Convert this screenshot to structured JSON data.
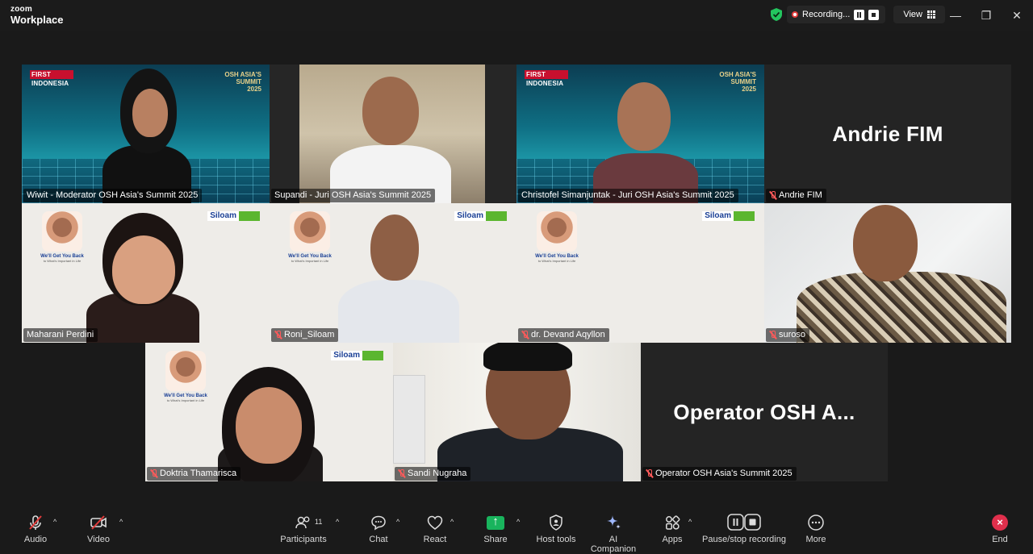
{
  "app": {
    "brand_small": "zoom",
    "brand_large": "Workplace"
  },
  "top": {
    "recording_label": "Recording...",
    "view_label": "View"
  },
  "window": {
    "minimize": "—",
    "restore": "❐",
    "close": "✕"
  },
  "participants": [
    {
      "name": "Wiwit - Moderator OSH Asia's Summit 2025",
      "muted": false,
      "active": true
    },
    {
      "name": "Supandi - Juri OSH Asia's Summit 2025",
      "muted": false
    },
    {
      "name": "Christofel Simanjuntak - Juri OSH Asia's Summit 2025",
      "muted": false
    },
    {
      "name": "Andrie FIM",
      "muted": true,
      "display": "Andrie FIM"
    },
    {
      "name": "Maharani Perdini",
      "muted": false
    },
    {
      "name": "Roni_Siloam",
      "muted": true
    },
    {
      "name": "dr. Devand Aqyllon",
      "muted": true
    },
    {
      "name": "suroso",
      "muted": true
    },
    {
      "name": "Doktria Thamarisca",
      "muted": true
    },
    {
      "name": "Sandi Nugraha",
      "muted": true
    },
    {
      "name": "Operator OSH Asia's Summit 2025",
      "muted": true,
      "display": "Operator OSH A..."
    }
  ],
  "backgrounds": {
    "first_indonesia": "FIRST INDONESIA",
    "osh_summit": [
      "OSH ASIA'S",
      "SUMMIT",
      "2025"
    ],
    "siloam": "Siloam",
    "siloam_tag": "Hospitals",
    "siloam_poster_title": "We'll Get You Back",
    "siloam_poster_sub": "to What's Important in Life"
  },
  "toolbar": {
    "audio": "Audio",
    "video": "Video",
    "participants": "Participants",
    "participants_count": "11",
    "chat": "Chat",
    "react": "React",
    "share": "Share",
    "host_tools": "Host tools",
    "ai_companion": "AI Companion",
    "apps": "Apps",
    "pause_stop": "Pause/stop recording",
    "more": "More",
    "end": "End"
  },
  "colors": {
    "active_speaker": "#2dd38a",
    "recording": "#e23b3b",
    "end": "#e02f4c",
    "share": "#19b45d"
  }
}
